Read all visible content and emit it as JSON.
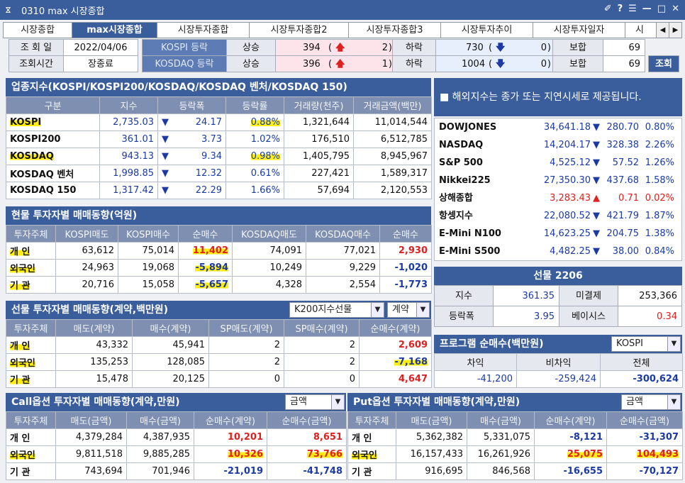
{
  "window": {
    "icon": "pin-icon",
    "title": "0310 max 시장종합",
    "controls": [
      "✐",
      "?",
      "☰",
      "—",
      "□",
      "✕"
    ]
  },
  "tabs": [
    "시장종합",
    "max시장종합",
    "시장투자종합",
    "시장투자종합2",
    "시장투자종합3",
    "시장투자추이",
    "시장투자일자",
    "시"
  ],
  "info": {
    "date_label": "조 회 일",
    "date_value": "2022/04/06",
    "time_label": "조회시간",
    "time_value": "장종료",
    "kospi_label": "KOSPI  등락",
    "kosdaq_label": "KOSDAQ 등락",
    "rise": "상승",
    "fall": "하락",
    "flat": "보합",
    "kospi_rise": "394",
    "kospi_rise_limit": "2",
    "kospi_fall": "730",
    "kospi_fall_limit": "0",
    "kospi_flat": "69",
    "kosdaq_rise": "396",
    "kosdaq_rise_limit": "1",
    "kosdaq_fall": "1004",
    "kosdaq_fall_limit": "0",
    "kosdaq_flat": "69",
    "query_button": "조회"
  },
  "index": {
    "title": "업종지수(KOSPI/KOSPI200/KOSDAQ/KOSDAQ 벤처/KOSDAQ 150)",
    "headers": [
      "구분",
      "지수",
      "등락폭",
      "등락률",
      "거래량(천주)",
      "거래금액(백만)"
    ],
    "rows": [
      {
        "name": "KOSPI",
        "index": "2,735.03",
        "dir": "▼",
        "change": "24.17",
        "rate": "0.88%",
        "volume": "1,321,644",
        "amount": "11,014,544"
      },
      {
        "name": "KOSPI200",
        "index": "361.01",
        "dir": "▼",
        "change": "3.73",
        "rate": "1.02%",
        "volume": "176,510",
        "amount": "6,512,785"
      },
      {
        "name": "KOSDAQ",
        "index": "943.13",
        "dir": "▼",
        "change": "9.34",
        "rate": "0.98%",
        "volume": "1,405,795",
        "amount": "8,945,967"
      },
      {
        "name": "KOSDAQ 벤처",
        "index": "1,998.85",
        "dir": "▼",
        "change": "12.32",
        "rate": "0.61%",
        "volume": "227,421",
        "amount": "1,589,317"
      },
      {
        "name": "KOSDAQ 150",
        "index": "1,317.42",
        "dir": "▼",
        "change": "22.29",
        "rate": "1.66%",
        "volume": "57,694",
        "amount": "2,120,553"
      }
    ]
  },
  "spot": {
    "title": "현물 투자자별 매매동향(억원)",
    "headers": [
      "투자주체",
      "KOSPI매도",
      "KOSPI매수",
      "순매수",
      "KOSDAQ매도",
      "KOSDAQ매수",
      "순매수"
    ],
    "rows": [
      {
        "name": "개  인",
        "a": "63,612",
        "b": "75,014",
        "c": "11,402",
        "d": "74,091",
        "e": "77,021",
        "f": "2,930"
      },
      {
        "name": "외국인",
        "a": "24,963",
        "b": "19,068",
        "c": "-5,894",
        "d": "10,249",
        "e": "9,229",
        "f": "-1,020"
      },
      {
        "name": "기  관",
        "a": "20,716",
        "b": "15,058",
        "c": "-5,657",
        "d": "4,328",
        "e": "2,554",
        "f": "-1,773"
      }
    ]
  },
  "futures": {
    "title": "선물 투자자별 매매동향(계약,백만원)",
    "select1": "K200지수선물",
    "select2": "계약",
    "headers": [
      "투자주체",
      "매도(계약)",
      "매수(계약)",
      "SP매도(계약)",
      "SP매수(계약)",
      "순매수(계약)"
    ],
    "rows": [
      {
        "name": "개  인",
        "a": "43,332",
        "b": "45,941",
        "c": "2",
        "d": "2",
        "e": "2,609"
      },
      {
        "name": "외국인",
        "a": "135,253",
        "b": "128,085",
        "c": "2",
        "d": "2",
        "e": "-7,168"
      },
      {
        "name": "기  관",
        "a": "15,478",
        "b": "20,125",
        "c": "0",
        "d": "0",
        "e": "4,647"
      }
    ]
  },
  "call": {
    "title": "Call옵션 투자자별 매매동향(계약,만원)",
    "select": "금액",
    "headers": [
      "투자주체",
      "매도(금액)",
      "매수(금액)",
      "순매수(계약)",
      "순매수(금액)"
    ],
    "rows": [
      {
        "name": "개  인",
        "a": "4,379,284",
        "b": "4,387,935",
        "c": "10,201",
        "d": "8,651"
      },
      {
        "name": "외국인",
        "a": "9,811,518",
        "b": "9,885,285",
        "c": "10,326",
        "d": "73,766"
      },
      {
        "name": "기  관",
        "a": "743,694",
        "b": "701,946",
        "c": "-21,019",
        "d": "-41,748"
      }
    ]
  },
  "put": {
    "title": "Put옵션 투자자별 매매동향(계약,만원)",
    "select": "금액",
    "headers": [
      "투자주체",
      "매도(금액)",
      "매수(금액)",
      "순매수(계약)",
      "순매수(금액)"
    ],
    "rows": [
      {
        "name": "개  인",
        "a": "5,362,382",
        "b": "5,331,075",
        "c": "-8,121",
        "d": "-31,307"
      },
      {
        "name": "외국인",
        "a": "16,157,433",
        "b": "16,261,926",
        "c": "25,075",
        "d": "104,493"
      },
      {
        "name": "기  관",
        "a": "916,695",
        "b": "846,568",
        "c": "-16,655",
        "d": "-70,127"
      }
    ]
  },
  "world": {
    "note": "■ 해외지수는 종가 또는 지연시세로 제공됩니다.",
    "rows": [
      {
        "name": "DOWJONES",
        "value": "34,641.18",
        "dir": "▼",
        "change": "280.70",
        "rate": "0.80%",
        "up": false
      },
      {
        "name": "NASDAQ",
        "value": "14,204.17",
        "dir": "▼",
        "change": "328.38",
        "rate": "2.26%",
        "up": false
      },
      {
        "name": "S&P 500",
        "value": "4,525.12",
        "dir": "▼",
        "change": "57.52",
        "rate": "1.26%",
        "up": false
      },
      {
        "name": "Nikkei225",
        "value": "27,350.30",
        "dir": "▼",
        "change": "437.68",
        "rate": "1.58%",
        "up": false
      },
      {
        "name": "상해종합",
        "value": "3,283.43",
        "dir": "▲",
        "change": "0.71",
        "rate": "0.02%",
        "up": true
      },
      {
        "name": "항셍지수",
        "value": "22,080.52",
        "dir": "▼",
        "change": "421.79",
        "rate": "1.87%",
        "up": false
      },
      {
        "name": "E-Mini N100",
        "value": "14,623.25",
        "dir": "▼",
        "change": "204.75",
        "rate": "1.38%",
        "up": false
      },
      {
        "name": "E-Mini S500",
        "value": "4,482.25",
        "dir": "▼",
        "change": "38.00",
        "rate": "0.84%",
        "up": false
      }
    ]
  },
  "fut2206": {
    "title": "선물 2206",
    "index_label": "지수",
    "index_value": "361.35",
    "oi_label": "미결제",
    "oi_value": "253,366",
    "chg_label": "등락폭",
    "chg_dir": "▼",
    "chg_value": "3.95",
    "basis_label": "베이시스",
    "basis_value": "0.34"
  },
  "program": {
    "title": "프로그램 순매수(백만원)",
    "select": "KOSPI",
    "headers": [
      "차익",
      "비차익",
      "전체"
    ],
    "values": [
      "-41,200",
      "-259,424",
      "-300,624"
    ]
  }
}
